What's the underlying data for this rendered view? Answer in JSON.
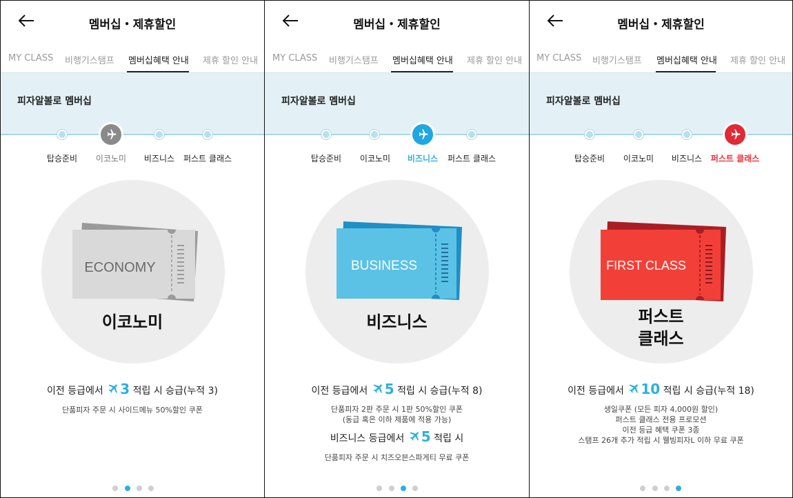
{
  "screens": [
    {
      "title": "멤버십・제휴할인",
      "tabs": [
        "MY CLASS",
        "비행기스탬프",
        "멤버십혜택 안내",
        "제휴 할인 안내"
      ],
      "section_title": "피자알볼로 멤버십",
      "steps": [
        "탑승준비",
        "이코노미",
        "비즈니스",
        "퍼스트 클래스"
      ],
      "active_step": 1,
      "ticket_text": "ECONOMY",
      "grade_name": "이코노미",
      "rule": {
        "prefix": "이전 등급에서",
        "count": "3",
        "suffix": "적립 시 승급(누적 3)"
      },
      "benefits": [
        "단품피자 주문 시 사이드메뉴 50%할인 쿠폰"
      ],
      "page_index": 1
    },
    {
      "title": "멤버십・제휴할인",
      "tabs": [
        "MY CLASS",
        "비행기스탬프",
        "멤버십혜택 안내",
        "제휴 할인 안내"
      ],
      "section_title": "피자알볼로 멤버십",
      "steps": [
        "탑승준비",
        "이코노미",
        "비즈니스",
        "퍼스트 클래스"
      ],
      "active_step": 2,
      "ticket_text": "BUSINESS",
      "grade_name": "비즈니스",
      "rule": {
        "prefix": "이전 등급에서",
        "count": "5",
        "suffix": "적립 시 승급(누적 8)"
      },
      "benefits": [
        "단품피자 2판 주문 시 1판 50%할인 쿠폰",
        "(동급 혹은 이하 제품에 적용 가능)"
      ],
      "rule2": {
        "prefix": "비즈니스 등급에서",
        "count": "5",
        "suffix": "적립 시"
      },
      "benefits2": [
        "단품피자 주문 시 치즈오븐스파게티 무료 쿠폰"
      ],
      "page_index": 2
    },
    {
      "title": "멤버십・제휴할인",
      "tabs": [
        "MY CLASS",
        "비행기스탬프",
        "멤버십혜택 안내",
        "제휴 할인 안내"
      ],
      "section_title": "피자알볼로 멤버십",
      "steps": [
        "탑승준비",
        "이코노미",
        "비즈니스",
        "퍼스트 클래스"
      ],
      "active_step": 3,
      "ticket_text": "FIRST CLASS",
      "grade_name": "퍼스트 클래스",
      "grade_name_lines": [
        "퍼스트",
        "클래스"
      ],
      "rule": {
        "prefix": "이전 등급에서",
        "count": "10",
        "suffix": "적립 시 승급(누적 18)"
      },
      "benefits": [
        "생일쿠폰 (모든 피자 4,000원 할인)",
        "퍼스트 클래스 전용 프로모션",
        "이전 등급 혜택 쿠폰 3종",
        "스탬프 26개 추가 적립 시 웰빙피자L 이하 무료 쿠폰"
      ],
      "page_index": 3
    }
  ],
  "colors": {
    "accent_blue": "#2bb0e0",
    "economy_active": "#8a8a8a",
    "business_active": "#1ea7e0",
    "first_active": "#e02a35",
    "first_label": "#e8303a",
    "ticket_economy": "#d9d9d9",
    "ticket_business": "#5bc2e6",
    "ticket_first": "#f24038",
    "band": "#e3f1f6",
    "step_dot": "#b6e1ee"
  },
  "icons": {
    "back": "arrow-left-icon",
    "active_step": "airplane-icon",
    "stamp": "airplane-icon"
  }
}
